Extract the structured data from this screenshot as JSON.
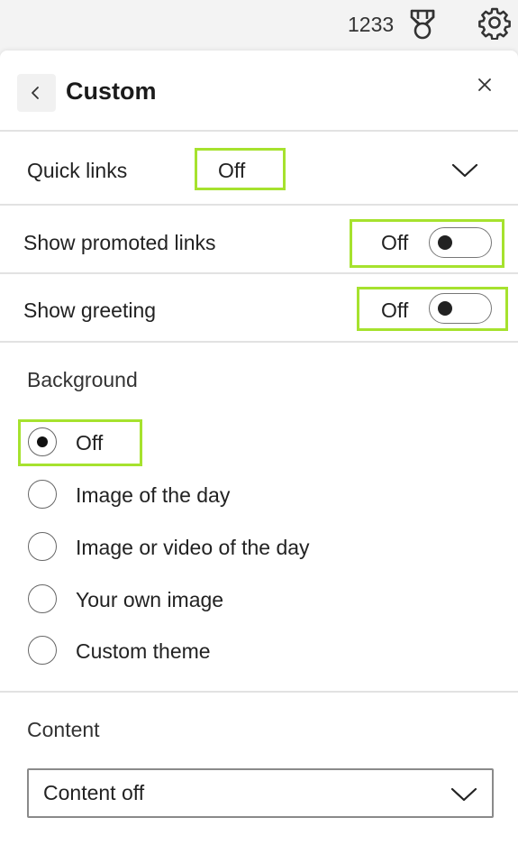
{
  "topbar": {
    "points": "1233",
    "medal_icon": "medal-icon",
    "settings_icon": "gear-icon"
  },
  "panel": {
    "title": "Custom",
    "back_icon": "chevron-left-icon",
    "close_icon": "close-icon"
  },
  "quick_links": {
    "label": "Quick links",
    "value": "Off",
    "expand_icon": "chevron-down-icon"
  },
  "promoted_links": {
    "label": "Show promoted links",
    "state": "Off"
  },
  "greeting": {
    "label": "Show greeting",
    "state": "Off"
  },
  "background": {
    "title": "Background",
    "options": [
      {
        "label": "Off",
        "selected": true
      },
      {
        "label": "Image of the day",
        "selected": false
      },
      {
        "label": "Image or video of the day",
        "selected": false
      },
      {
        "label": "Your own image",
        "selected": false
      },
      {
        "label": "Custom theme",
        "selected": false
      }
    ]
  },
  "content": {
    "title": "Content",
    "selected": "Content off",
    "dropdown_icon": "chevron-down-icon"
  },
  "colors": {
    "highlight": "#a6e22e",
    "panel_bg": "#ffffff",
    "page_bg": "#f3f3f3"
  }
}
